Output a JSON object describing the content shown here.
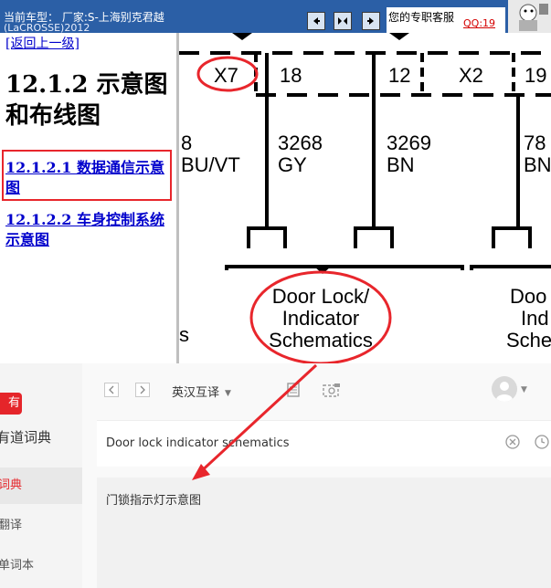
{
  "header": {
    "car_line": "当前车型： 厂家:S-上海别克君越",
    "car_line2": "(LaCROSSE)2012",
    "service_text": "您的专职客服",
    "qq": "QQ:19"
  },
  "nav": {
    "back": "[返回上一级]",
    "title": "12.1.2 示意图和布线图",
    "links": [
      "12.1.2.1 数据通信示意图",
      "12.1.2.2 车身控制系统示意图"
    ]
  },
  "schematic": {
    "connectors": [
      "X7",
      "18",
      "12",
      "X2",
      "19"
    ],
    "circuits": [
      {
        "number": "8",
        "color": "BU/VT"
      },
      {
        "number": "3268",
        "color": "GY"
      },
      {
        "number": "3269",
        "color": "BN"
      },
      {
        "number": "78",
        "color": "BN"
      }
    ],
    "label_main": [
      "Door Lock/",
      "Indicator",
      "Schematics"
    ],
    "label_side": [
      "Doo",
      "Ind",
      "Sche"
    ],
    "label_left": "s"
  },
  "dictionary": {
    "logo": "有道",
    "brand": "有道词典",
    "menu": [
      "词典",
      "翻译",
      "单词本"
    ],
    "mode": "英汉互译",
    "input_value": "Door lock indicator schematics",
    "result": "门锁指示灯示意图"
  },
  "colors": {
    "header_blue": "#2b5fa6",
    "annotation_red": "#e8262c",
    "link_blue": "#0000cc",
    "youdao_red": "#e5252a"
  }
}
